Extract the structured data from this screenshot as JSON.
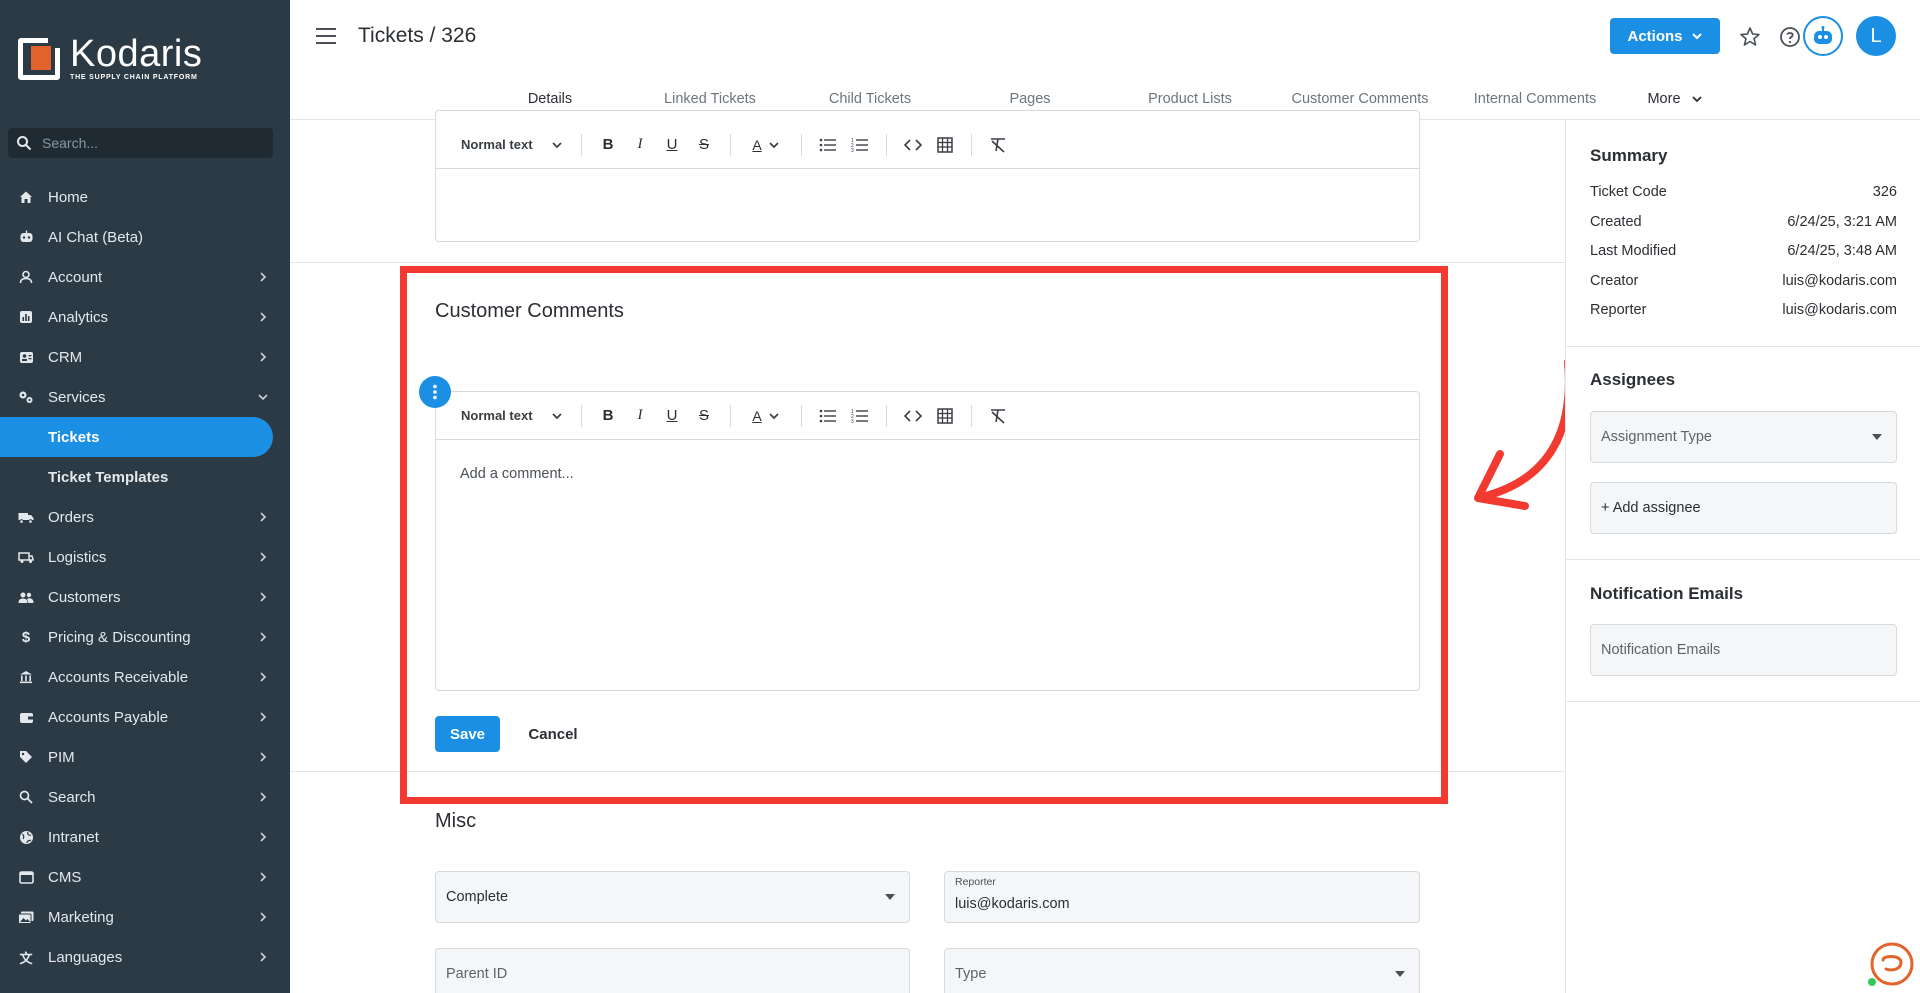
{
  "brand": {
    "name": "Kodaris",
    "tagline": "THE SUPPLY CHAIN PLATFORM"
  },
  "search": {
    "placeholder": "Search..."
  },
  "sidebar": {
    "items": [
      {
        "label": "Home",
        "icon": "home-icon"
      },
      {
        "label": "AI Chat (Beta)",
        "icon": "robot-icon"
      },
      {
        "label": "Account",
        "icon": "person-icon"
      },
      {
        "label": "Analytics",
        "icon": "chart-icon"
      },
      {
        "label": "CRM",
        "icon": "contact-card-icon"
      },
      {
        "label": "Services",
        "icon": "gears-icon"
      },
      {
        "label": "Tickets"
      },
      {
        "label": "Ticket Templates"
      },
      {
        "label": "Orders",
        "icon": "truck-icon"
      },
      {
        "label": "Logistics",
        "icon": "shipping-icon"
      },
      {
        "label": "Customers",
        "icon": "people-icon"
      },
      {
        "label": "Pricing & Discounting",
        "icon": "dollar-icon"
      },
      {
        "label": "Accounts Receivable",
        "icon": "bank-icon"
      },
      {
        "label": "Accounts Payable",
        "icon": "wallet-icon"
      },
      {
        "label": "PIM",
        "icon": "tag-icon"
      },
      {
        "label": "Search",
        "icon": "search-icon"
      },
      {
        "label": "Intranet",
        "icon": "globe-icon"
      },
      {
        "label": "CMS",
        "icon": "browser-icon"
      },
      {
        "label": "Marketing",
        "icon": "photos-icon"
      },
      {
        "label": "Languages",
        "icon": "translate-icon"
      }
    ]
  },
  "header": {
    "title": "Tickets / 326",
    "actions_label": "Actions",
    "avatar_initial": "L"
  },
  "tabs": [
    {
      "label": "Details",
      "active": true
    },
    {
      "label": "Linked Tickets"
    },
    {
      "label": "Child Tickets"
    },
    {
      "label": "Pages"
    },
    {
      "label": "Product Lists"
    },
    {
      "label": "Customer Comments"
    },
    {
      "label": "Internal Comments"
    },
    {
      "label": "More"
    }
  ],
  "editor": {
    "format_label": "Normal text",
    "comment_placeholder": "Add a comment..."
  },
  "customer_comments": {
    "title": "Customer Comments",
    "save_label": "Save",
    "cancel_label": "Cancel"
  },
  "misc": {
    "title": "Misc",
    "status_value": "Complete",
    "reporter_label": "Reporter",
    "reporter_value": "luis@kodaris.com",
    "parent_id_placeholder": "Parent ID",
    "type_placeholder": "Type"
  },
  "summary": {
    "title": "Summary",
    "rows": [
      {
        "key": "Ticket Code",
        "value": "326"
      },
      {
        "key": "Created",
        "value": "6/24/25, 3:21 AM"
      },
      {
        "key": "Last Modified",
        "value": "6/24/25, 3:48 AM"
      },
      {
        "key": "Creator",
        "value": "luis@kodaris.com"
      },
      {
        "key": "Reporter",
        "value": "luis@kodaris.com"
      }
    ]
  },
  "assignees": {
    "title": "Assignees",
    "assignment_type_placeholder": "Assignment Type",
    "add_assignee_label": "+ Add assignee"
  },
  "notifications": {
    "title": "Notification Emails",
    "placeholder": "Notification Emails"
  },
  "colors": {
    "accent": "#1a8fe3",
    "sidebar_bg": "#2c3a45",
    "highlight": "#f23a30",
    "logo_orange": "#e2632b"
  }
}
